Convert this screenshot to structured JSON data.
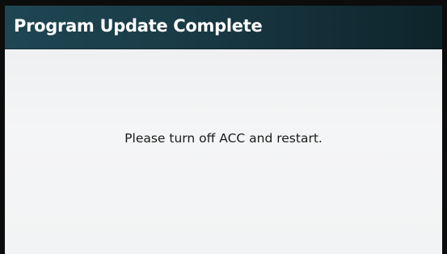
{
  "window": {
    "title": "Program Update Complete"
  },
  "main": {
    "message": "Please turn off ACC and restart."
  },
  "colors": {
    "title_bar": "#1a3d48",
    "title_text": "#ffffff",
    "content_background": "#f2f3f4",
    "message_text": "#1a1a1a",
    "bezel": "#0c0c0c"
  }
}
